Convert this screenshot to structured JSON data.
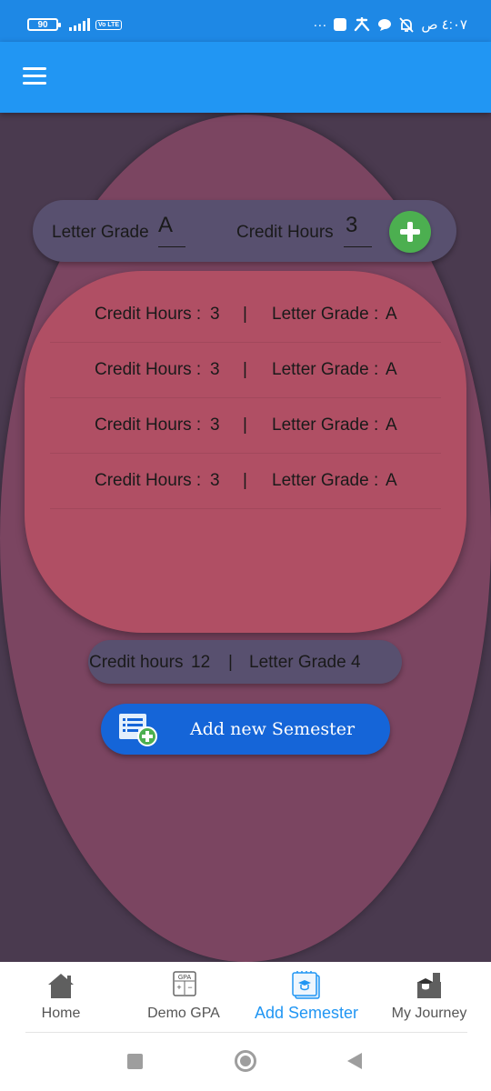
{
  "status_bar": {
    "battery": "90",
    "volte": "Vo LTE",
    "more": "···",
    "time": "٤:٠٧ ص"
  },
  "form": {
    "letter_grade_label": "Letter Grade",
    "letter_grade_value": "A",
    "credit_hours_label": "Credit Hours",
    "credit_hours_value": "3"
  },
  "courses": [
    {
      "credit_label": "Credit Hours :",
      "credit_value": "3",
      "separator": "|",
      "grade_label": "Letter Grade :",
      "grade_value": "A"
    },
    {
      "credit_label": "Credit Hours :",
      "credit_value": "3",
      "separator": "|",
      "grade_label": "Letter Grade :",
      "grade_value": "A"
    },
    {
      "credit_label": "Credit Hours :",
      "credit_value": "3",
      "separator": "|",
      "grade_label": "Letter Grade :",
      "grade_value": "A"
    },
    {
      "credit_label": "Credit Hours :",
      "credit_value": "3",
      "separator": "|",
      "grade_label": "Letter Grade :",
      "grade_value": "A"
    }
  ],
  "summary": {
    "credit_label": "Credit hours",
    "credit_value": "12",
    "separator": "|",
    "grade_label": "Letter Grade",
    "grade_value": "4"
  },
  "add_semester_button": {
    "label": "Add new Semester"
  },
  "bottom_nav": {
    "items": [
      {
        "label": "Home",
        "icon": "home-icon"
      },
      {
        "label": "Demo GPA",
        "icon": "calculator-icon",
        "icon_text": "GPA"
      },
      {
        "label": "Add Semester",
        "icon": "notebook-icon",
        "active": true
      },
      {
        "label": "My Journey",
        "icon": "graduation-icon"
      }
    ]
  },
  "colors": {
    "app_bar": "#2196f3",
    "background": "#4a3a4f",
    "outer_oval": "#7b4561",
    "list_box": "#b04f64",
    "pill": "#58506f",
    "accent_green": "#4caf50",
    "button_blue": "#1565d8"
  }
}
